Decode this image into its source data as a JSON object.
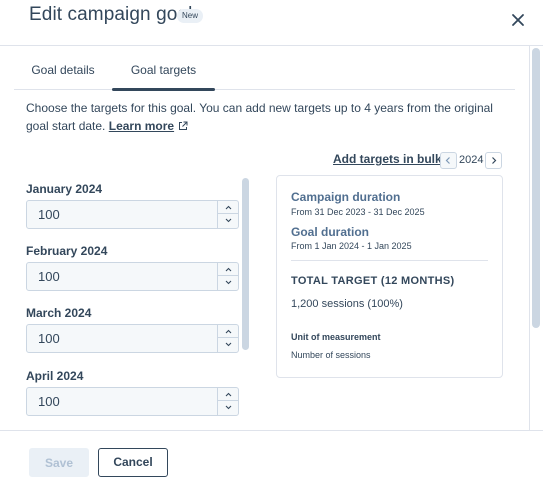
{
  "header": {
    "title": "Edit campaign goal",
    "badge": "New",
    "close_icon": "close-icon"
  },
  "tabs": [
    {
      "label": "Goal details",
      "active": false
    },
    {
      "label": "Goal targets",
      "active": true
    }
  ],
  "intro": {
    "text": "Choose the targets for this goal. You can add new targets up to 4 years from the original goal start date.",
    "link_label": "Learn more",
    "link_icon": "external-link-icon"
  },
  "targets_toolbar": {
    "add_bulk_label": "Add targets in bulk",
    "year": "2024",
    "prev_icon": "chevron-left-icon",
    "next_icon": "chevron-right-icon"
  },
  "months": [
    {
      "label": "January 2024",
      "value": "100"
    },
    {
      "label": "February 2024",
      "value": "100"
    },
    {
      "label": "March 2024",
      "value": "100"
    },
    {
      "label": "April 2024",
      "value": "100"
    }
  ],
  "summary": {
    "campaign_duration_label": "Campaign duration",
    "campaign_duration_value": "From 31 Dec 2023 - 31 Dec 2025",
    "goal_duration_label": "Goal duration",
    "goal_duration_value": "From 1 Jan 2024 - 1 Jan 2025",
    "total_target_label": "TOTAL TARGET (12 MONTHS)",
    "total_target_value": "1,200 sessions (100%)",
    "unit_label": "Unit of measurement",
    "unit_value": "Number of sessions"
  },
  "footer": {
    "save_label": "Save",
    "cancel_label": "Cancel"
  },
  "colors": {
    "text": "#33475b",
    "border": "#dfe3eb",
    "input_bg": "#f5f8fa",
    "disabled_bg": "#eaf0f6",
    "disabled_text": "#b0c1d4"
  }
}
